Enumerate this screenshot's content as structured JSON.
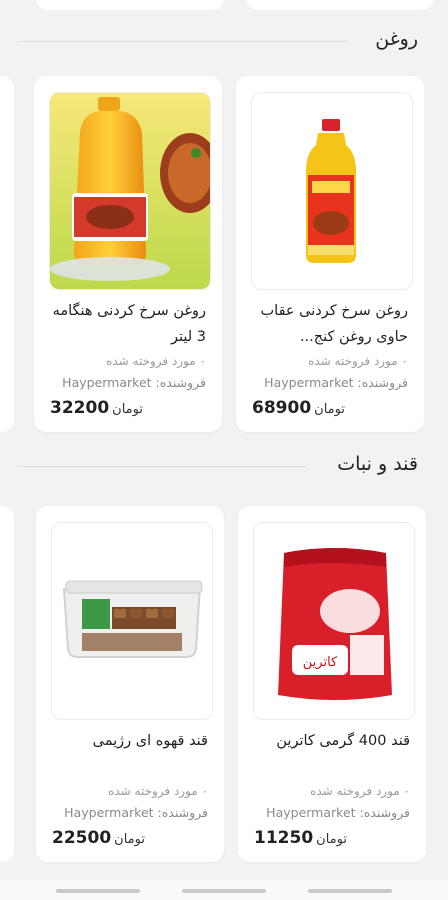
{
  "sections": [
    {
      "title": "روغن",
      "products": [
        {
          "title": "روغن سرخ کردنی عقاب حاوی روغن کنج...",
          "sold": "۰ مورد فروخته شده",
          "seller": "فروشنده: Haypermarket",
          "price": "68900",
          "currency": "تومان",
          "image_icon": "oil-bottle-image"
        },
        {
          "title": "روغن سرخ کردنی هنگامه 3 لیتر",
          "sold": "۰ مورد فروخته شده",
          "seller": "فروشنده: Haypermarket",
          "price": "32200",
          "currency": "تومان",
          "image_icon": "oil-jug-image"
        }
      ]
    },
    {
      "title": "قند و نبات",
      "products": [
        {
          "title": "قند 400 گرمی کاترین",
          "sold": "۰ مورد فروخته شده",
          "seller": "فروشنده: Haypermarket",
          "price": "11250",
          "currency": "تومان",
          "image_icon": "sugar-bag-image",
          "image_brand": "کاترین"
        },
        {
          "title": "قند قهوه ای رژیمی",
          "sold": "۰ مورد فروخته شده",
          "seller": "فروشنده: Haypermarket",
          "price": "22500",
          "currency": "تومان",
          "image_icon": "sugar-box-image"
        }
      ]
    }
  ],
  "colors": {
    "background": "#f2f2f2",
    "card": "#ffffff",
    "text": "#222222",
    "muted": "#9a9a9a"
  }
}
